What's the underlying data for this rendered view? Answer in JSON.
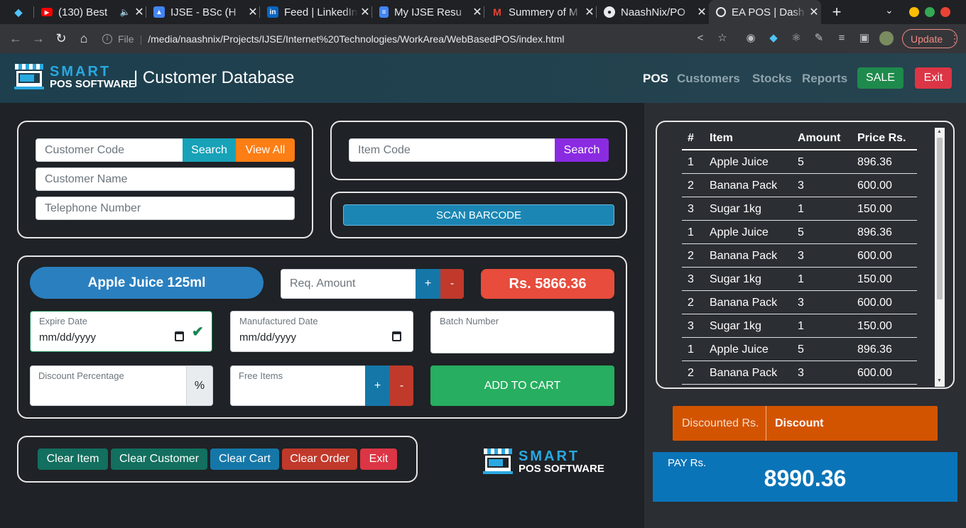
{
  "browser": {
    "tabs": [
      {
        "title": "",
        "icon": "gem-icon"
      },
      {
        "title": "(130) Best",
        "icon": "youtube-icon"
      },
      {
        "title": "IJSE - BSc (H",
        "icon": "image-icon"
      },
      {
        "title": "Feed | LinkedIn",
        "icon": "linkedin-icon"
      },
      {
        "title": "My IJSE Resu",
        "icon": "docs-icon"
      },
      {
        "title": "Summery of M",
        "icon": "gmail-icon"
      },
      {
        "title": "NaashNix/PO",
        "icon": "github-icon"
      },
      {
        "title": "EA POS | Dash",
        "icon": "globe-icon"
      }
    ],
    "file_label": "File",
    "url": "/media/naashnix/Projects/IJSE/Internet%20Technologies/WorkArea/WebBasedPOS/index.html",
    "update_label": "Update"
  },
  "header": {
    "logo_line1": "SMART",
    "logo_line2": "POS SOFTWARE",
    "title": "| Customer Database",
    "nav": [
      "POS",
      "Customers",
      "Stocks",
      "Reports"
    ],
    "sale_label": "SALE",
    "exit_label": "Exit"
  },
  "customer": {
    "code_placeholder": "Customer Code",
    "search_label": "Search",
    "view_all_label": "View All",
    "name_placeholder": "Customer Name",
    "phone_placeholder": "Telephone Number"
  },
  "item_search": {
    "code_placeholder": "Item Code",
    "search_label": "Search",
    "scan_label": "SCAN BARCODE"
  },
  "item": {
    "name": "Apple Juice 125ml",
    "req_amount_placeholder": "Req. Amount",
    "plus": "+",
    "minus": "-",
    "price": "Rs. 5866.36",
    "expire_label": "Expire Date",
    "expire_value": "mm/dd/yyyy",
    "manufactured_label": "Manufactured Date",
    "manufactured_value": "mm/dd/yyyy",
    "batch_label": "Batch Number",
    "discount_label": "Discount Percentage",
    "percent": "%",
    "free_label": "Free Items",
    "add_to_cart": "ADD TO CART"
  },
  "actions": {
    "clear_item": "Clear Item",
    "clear_customer": "Clear Customer",
    "clear_cart": "Clear Cart",
    "clear_order": "Clear Order",
    "exit": "Exit"
  },
  "cart": {
    "headers": [
      "#",
      "Item",
      "Amount",
      "Price Rs."
    ],
    "rows": [
      [
        "1",
        "Apple Juice",
        "5",
        "896.36"
      ],
      [
        "2",
        "Banana Pack",
        "3",
        "600.00"
      ],
      [
        "3",
        "Sugar 1kg",
        "1",
        "150.00"
      ],
      [
        "1",
        "Apple Juice",
        "5",
        "896.36"
      ],
      [
        "2",
        "Banana Pack",
        "3",
        "600.00"
      ],
      [
        "3",
        "Sugar 1kg",
        "1",
        "150.00"
      ],
      [
        "2",
        "Banana Pack",
        "3",
        "600.00"
      ],
      [
        "3",
        "Sugar 1kg",
        "1",
        "150.00"
      ],
      [
        "1",
        "Apple Juice",
        "5",
        "896.36"
      ],
      [
        "2",
        "Banana Pack",
        "3",
        "600.00"
      ]
    ]
  },
  "summary": {
    "discounted_label": "Discounted Rs.",
    "discount_label": "Discount",
    "pay_label": "PAY Rs.",
    "pay_value": "8990.36"
  },
  "colors": {
    "teal": "#17a2b8",
    "orange": "#fd7e14",
    "purple": "#8a2be2",
    "green": "#1e8a4c",
    "red": "#dc3545",
    "blue": "#1c81c3",
    "discount_bg": "#d35400"
  }
}
